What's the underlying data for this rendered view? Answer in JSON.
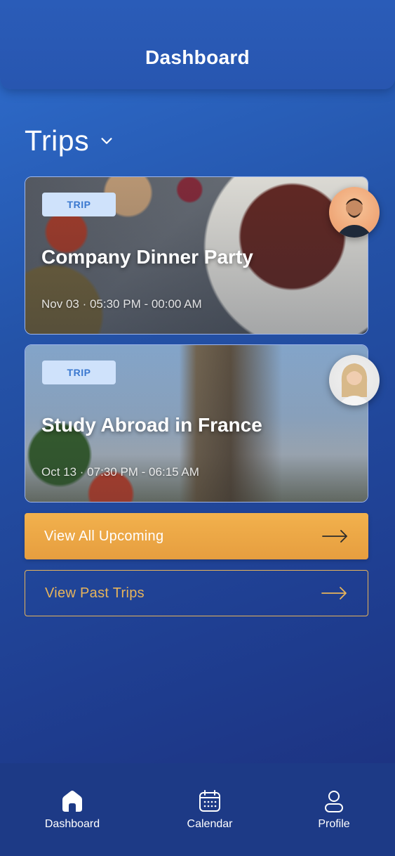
{
  "header": {
    "title": "Dashboard"
  },
  "section": {
    "title": "Trips"
  },
  "trips": [
    {
      "badge": "TRIP",
      "title": "Company Dinner Party",
      "time": "Nov 03 · 05:30 PM - 00:00 AM"
    },
    {
      "badge": "TRIP",
      "title": "Study Abroad in France",
      "time": "Oct 13 · 07:30 PM - 06:15 AM"
    }
  ],
  "buttons": {
    "upcoming": "View All Upcoming",
    "past": "View Past Trips"
  },
  "tabbar": {
    "items": [
      {
        "label": "Dashboard",
        "icon": "home-icon"
      },
      {
        "label": "Calendar",
        "icon": "calendar-icon"
      },
      {
        "label": "Profile",
        "icon": "profile-icon"
      }
    ]
  },
  "colors": {
    "accent": "#E69E3F",
    "outline": "#E7B45B",
    "badge_bg": "#CFE2FB",
    "badge_text": "#3A78CF",
    "background": "#2453A8",
    "tabbar": "#1D3A86"
  }
}
